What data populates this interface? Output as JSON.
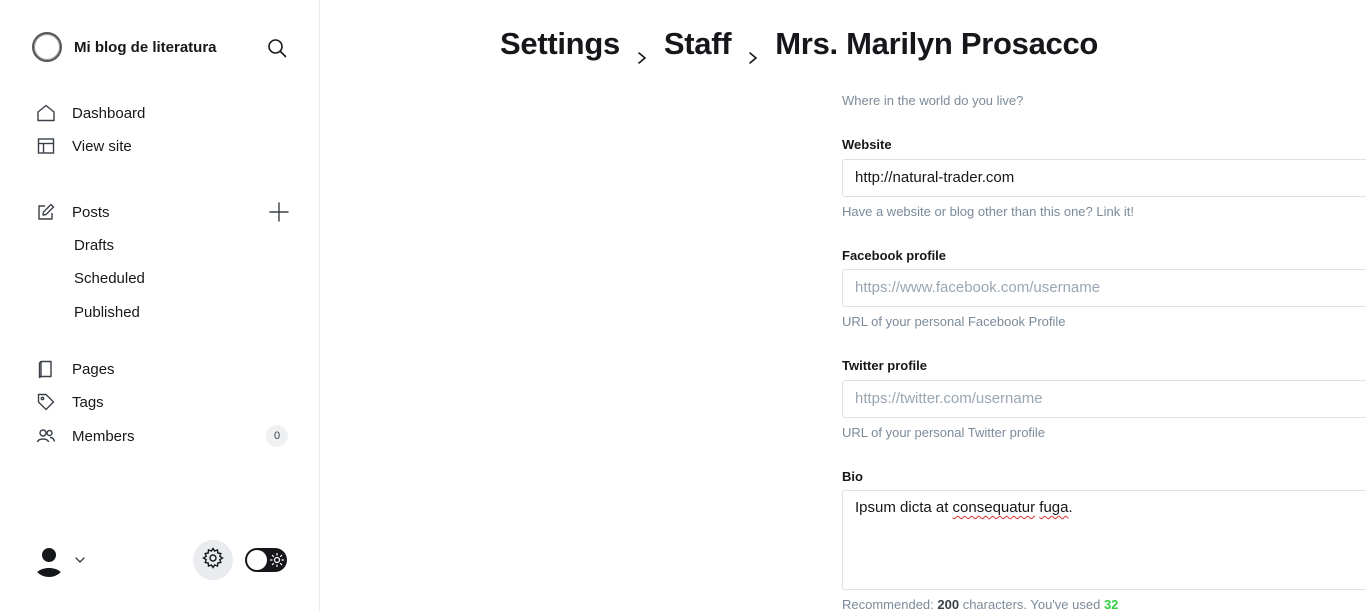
{
  "sidebar": {
    "site_title": "Mi blog de literatura",
    "nav": {
      "dashboard": "Dashboard",
      "view_site": "View site",
      "posts": "Posts",
      "drafts": "Drafts",
      "scheduled": "Scheduled",
      "published": "Published",
      "pages": "Pages",
      "tags": "Tags",
      "members": "Members",
      "members_count": "0"
    }
  },
  "breadcrumb": {
    "settings": "Settings",
    "staff": "Staff",
    "user": "Mrs. Marilyn Prosacco"
  },
  "form": {
    "location_hint": "Where in the world do you live?",
    "website": {
      "label": "Website",
      "value": "http://natural-trader.com",
      "hint": "Have a website or blog other than this one? Link it!"
    },
    "facebook": {
      "label": "Facebook profile",
      "placeholder": "https://www.facebook.com/username",
      "hint": "URL of your personal Facebook Profile"
    },
    "twitter": {
      "label": "Twitter profile",
      "placeholder": "https://twitter.com/username",
      "hint": "URL of your personal Twitter profile"
    },
    "bio": {
      "label": "Bio",
      "text_start": "Ipsum dicta at ",
      "word1": "consequatur",
      "space": " ",
      "word2": "fuga",
      "text_end": ".",
      "count_prefix": "Recommended: ",
      "recommended": "200",
      "count_mid": " characters. You've used ",
      "used": "32"
    }
  },
  "icons": {
    "logo": "circle-logo-icon",
    "search": "search-icon",
    "home": "home-icon",
    "view_site": "layout-icon",
    "posts": "edit-icon",
    "plus": "plus-icon",
    "pages": "page-icon",
    "tags": "tag-icon",
    "members": "members-icon",
    "gear": "gear-icon"
  },
  "colors": {
    "accent_green": "#30cf43",
    "text": "#15171a",
    "muted": "#7c8b9a",
    "border": "#dde1e5"
  }
}
